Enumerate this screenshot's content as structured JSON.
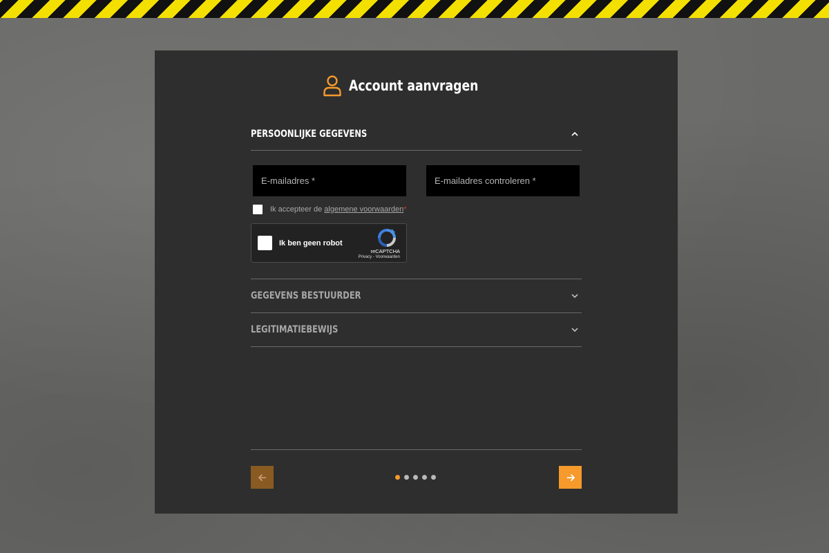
{
  "page": {
    "title": "Account aanvragen",
    "title_icon": "user-icon",
    "accent_color": "#f59a2b"
  },
  "sections": {
    "personal": {
      "label": "PERSOONLIJKE GEGEVENS",
      "state": "expanded"
    },
    "driver": {
      "label": "GEGEVENS BESTUURDER",
      "state": "collapsed"
    },
    "id": {
      "label": "LEGITIMATIEBEWIJS",
      "state": "collapsed"
    }
  },
  "form": {
    "email_placeholder": "E-mailadres *",
    "email_confirm_placeholder": "E-mailadres controleren *",
    "terms_prefix": "Ik accepteer de",
    "terms_link": "algemene voorwaarden",
    "terms_required": "*"
  },
  "captcha": {
    "label": "Ik ben geen robot",
    "brand": "reCAPTCHA",
    "links": "Privacy - Voorwaarden"
  },
  "stepper": {
    "total_steps": 5,
    "current_step": 1
  }
}
